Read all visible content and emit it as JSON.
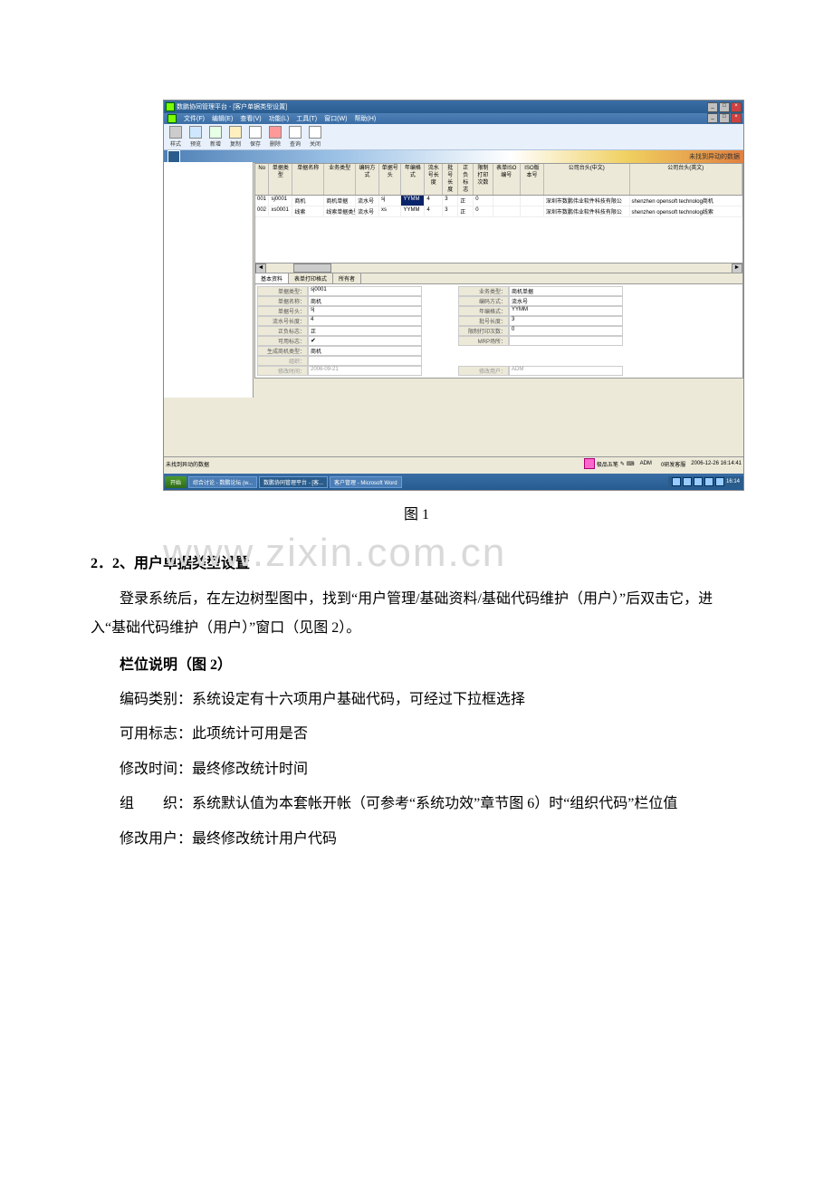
{
  "app": {
    "title": "数鹏协同管理平台 - [客户单据类型设置]"
  },
  "menu": [
    "文件(F)",
    "编辑(E)",
    "查看(V)",
    "功能(L)",
    "工具(T)",
    "窗口(W)",
    "帮助(H)"
  ],
  "toolbar": [
    {
      "label": "样式",
      "icon": "gray"
    },
    {
      "label": "预览",
      "icon": "preview"
    },
    {
      "label": "新增",
      "icon": "add"
    },
    {
      "label": "复制",
      "icon": "copy"
    },
    {
      "label": "保存",
      "icon": "save"
    },
    {
      "label": "删除",
      "icon": "del"
    },
    {
      "label": "查询",
      "icon": "find"
    },
    {
      "label": "关闭",
      "icon": "close"
    }
  ],
  "bluebar": {
    "right": "未找到异动的数据"
  },
  "grid": {
    "headers": [
      "No",
      "单据类型",
      "单据名称",
      "业务类型",
      "编码方式",
      "单据号头",
      "年编格式",
      "流水号长度",
      "批号长度",
      "正负标志",
      "限制打印次数",
      "表单ISO编号",
      "ISO版本号",
      "公司台头(中文)",
      "公司台头(英文)"
    ],
    "rows": [
      {
        "no": "001",
        "type": "sj0001",
        "name": "商机",
        "biz": "商机单据",
        "code": "流水号",
        "head": "sj",
        "yfmt": "YYMM",
        "flow": "4",
        "batch": "3",
        "sign": "正",
        "limit": "0",
        "iso": "",
        "isov": "",
        "czh": "深圳市数鹏伟业软件科技有限公",
        "cen": "shenzhen opensoft technolog商机",
        "hl": "yfmt"
      },
      {
        "no": "002",
        "type": "xs0001",
        "name": "线索",
        "biz": "线索单据类型",
        "code": "流水号",
        "head": "xs",
        "yfmt": "YYMM",
        "flow": "4",
        "batch": "3",
        "sign": "正",
        "limit": "0",
        "iso": "",
        "isov": "",
        "czh": "深圳市数鹏伟业软件科技有限公",
        "cen": "shenzhen opensoft technolog线索"
      }
    ]
  },
  "tabs": [
    "基本资料",
    "表单打印格式",
    "所有者"
  ],
  "detail": {
    "left": [
      {
        "label": "单据类型：",
        "value": "sj0001"
      },
      {
        "label": "单据名称：",
        "value": "商机"
      },
      {
        "label": "单据号头：",
        "value": "sj"
      },
      {
        "label": "流水号长度：",
        "value": "4"
      },
      {
        "label": "正负标志：",
        "value": "正"
      },
      {
        "label": "可用标志：",
        "value": "",
        "chk": true
      },
      {
        "label": "生成商机类型：",
        "value": "商机"
      },
      {
        "label": "组织：",
        "value": "",
        "gray": true
      },
      {
        "label": "修改时间：",
        "value": "2006-09-21",
        "gray": true
      }
    ],
    "right": [
      {
        "label": "业务类型：",
        "value": "商机单据"
      },
      {
        "label": "编码方式：",
        "value": "流水号"
      },
      {
        "label": "年编格式：",
        "value": "YYMM"
      },
      {
        "label": "批号长度：",
        "value": "3"
      },
      {
        "label": "限制打印次数：",
        "value": "0"
      },
      {
        "label": "MRP场所：",
        "value": ""
      },
      {
        "label": "",
        "value": ""
      },
      {
        "label": "",
        "value": ""
      },
      {
        "label": "修改用户：",
        "value": "ADM",
        "gray": true
      }
    ]
  },
  "status": {
    "left": "未找到异动的数据",
    "ime": "极品五笔",
    "user": "ADM",
    "dev": "0研发客服",
    "time": "2006-12-26 16:14:41"
  },
  "taskbar": {
    "start": "开始",
    "items": [
      "综合讨论 - 数鹏论坛 (w...",
      "数鹏协同管理平台 - [客...",
      "客户管理 - Microsoft Word"
    ],
    "clock": "16:14"
  },
  "caption1": "图 1",
  "watermark": "www.zixin.com.cn",
  "section": {
    "heading": "2．2、用户单据类型设置",
    "para1": "登录系统后，在左边树型图中，找到“用户管理/基础资料/基础代码维护（用户）”后双击它，进入“基础代码维护（用户）”窗口（见图 2）。",
    "subhead": "栏位说明（图 2）",
    "fields": [
      "编码类别：系统设定有十六项用户基础代码，可经过下拉框选择",
      "可用标志：此项统计可用是否",
      "修改时间：最终修改统计时间",
      "组　　织：系统默认值为本套帐开帐（可参考“系统功效”章节图 6）时“组织代码”栏位值",
      "修改用户：最终修改统计用户代码"
    ]
  }
}
